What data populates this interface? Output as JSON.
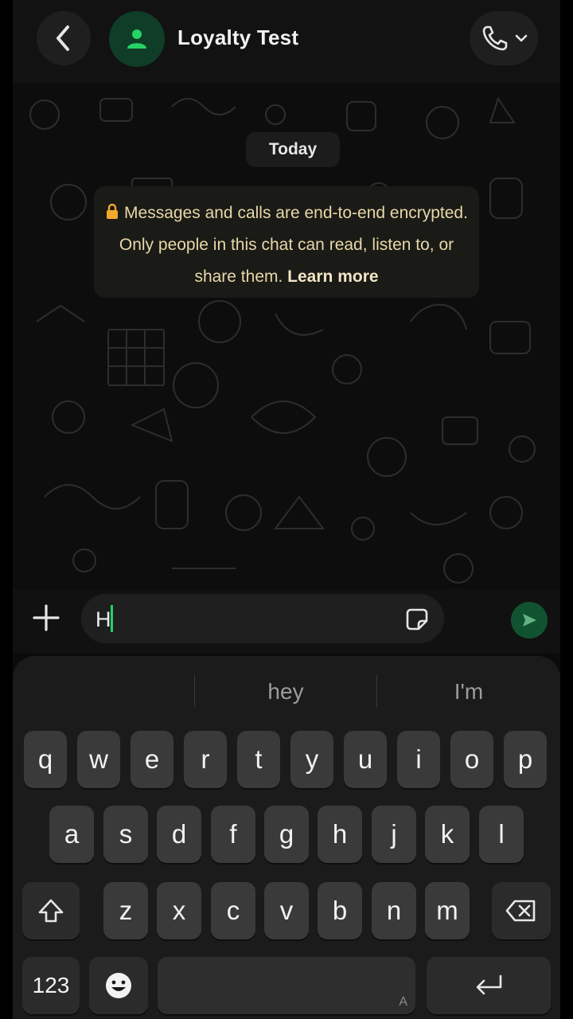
{
  "header": {
    "title": "Loyalty Test"
  },
  "chat": {
    "date_label": "Today",
    "encryption_notice": "Messages and calls are end-to-end encrypted. Only people in this chat can read, listen to, or share them.",
    "learn_more": "Learn more"
  },
  "composer": {
    "text": "H"
  },
  "suggestions": [
    "",
    "hey",
    "I'm"
  ],
  "keyboard": {
    "row1": [
      "q",
      "w",
      "e",
      "r",
      "t",
      "y",
      "u",
      "i",
      "o",
      "p"
    ],
    "row2": [
      "a",
      "s",
      "d",
      "f",
      "g",
      "h",
      "j",
      "k",
      "l"
    ],
    "row3": [
      "z",
      "x",
      "c",
      "v",
      "b",
      "n",
      "m"
    ],
    "numbers_key": "123",
    "space_mark": "A"
  },
  "colors": {
    "accent": "#25d366",
    "avatar_bg": "#0f3d27",
    "notice_text": "#e7d8a8"
  },
  "icons": [
    "back-icon",
    "person-icon",
    "phone-icon",
    "chevron-down-icon",
    "lock-icon",
    "plus-icon",
    "sticker-icon",
    "send-icon",
    "shift-icon",
    "backspace-icon",
    "emoji-icon",
    "return-icon"
  ]
}
